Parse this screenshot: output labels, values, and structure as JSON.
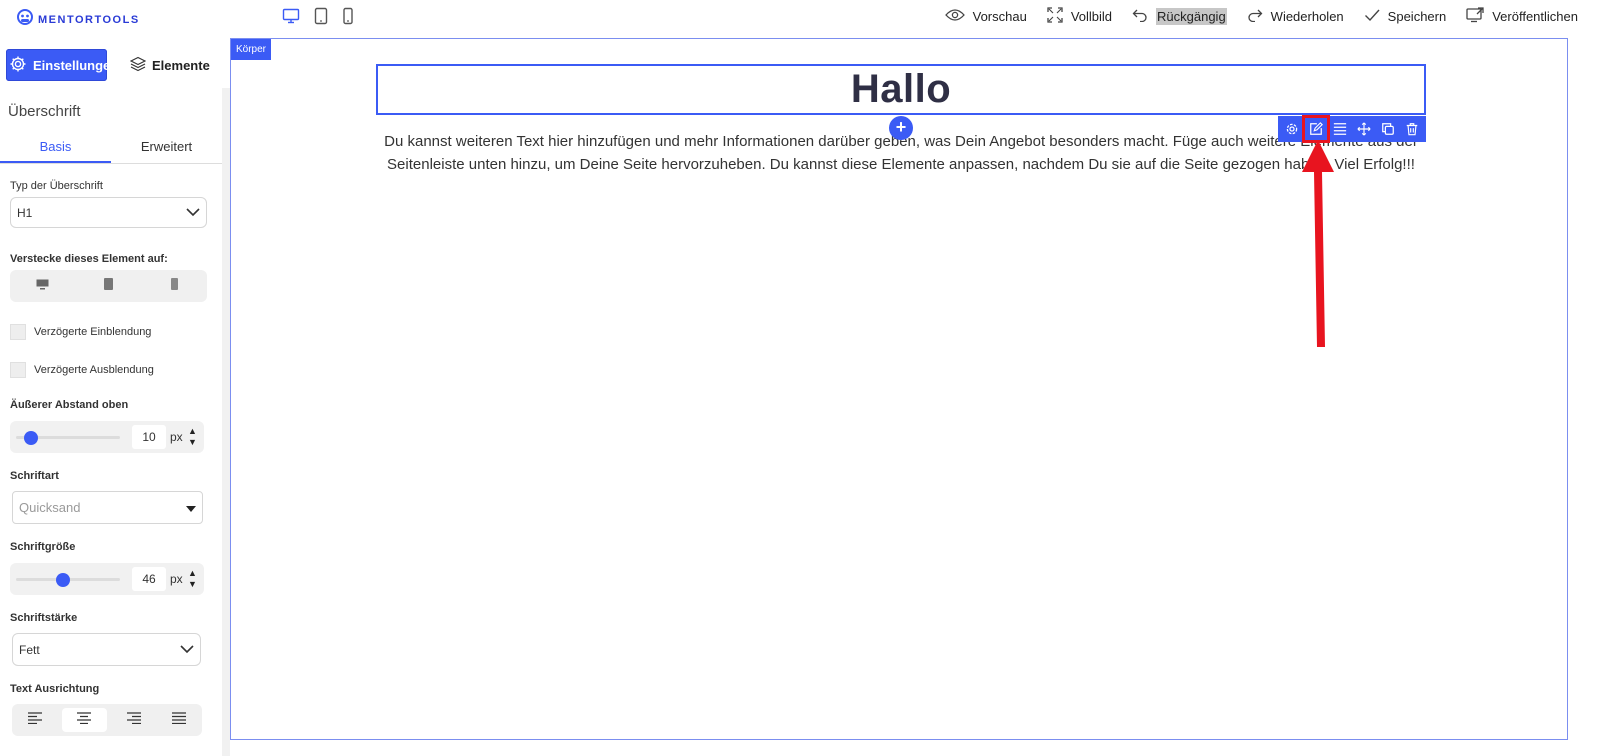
{
  "app": {
    "logo_text": "MENTORTOOLS"
  },
  "header": {
    "actions": [
      {
        "label": "Vorschau",
        "icon": "eye-icon"
      },
      {
        "label": "Vollbild",
        "icon": "fullscreen-icon"
      },
      {
        "label": "Rückgängig",
        "icon": "undo-icon",
        "highlighted": true
      },
      {
        "label": "Wiederholen",
        "icon": "redo-icon"
      },
      {
        "label": "Speichern",
        "icon": "check-icon"
      },
      {
        "label": "Veröffentlichen",
        "icon": "publish-icon"
      }
    ],
    "device_icons": [
      "desktop-icon",
      "tablet-icon",
      "mobile-icon"
    ]
  },
  "sidebar": {
    "settings_label": "Einstellungen",
    "elements_label": "Elemente",
    "panel_title": "Überschrift",
    "tabs": [
      "Basis",
      "Erweitert"
    ],
    "active_tab": "Basis",
    "heading_type_label": "Typ der Überschrift",
    "heading_type_value": "H1",
    "hide_label": "Verstecke dieses Element auf:",
    "delayed_show_label": "Verzögerte Einblendung",
    "delayed_hide_label": "Verzögerte Ausblendung",
    "margin_top_label": "Äußerer Abstand oben",
    "margin_top_value": "10",
    "margin_top_unit": "px",
    "font_label": "Schriftart",
    "font_placeholder": "Quicksand",
    "font_size_label": "Schriftgröße",
    "font_size_value": "46",
    "font_size_unit": "px",
    "font_weight_label": "Schriftstärke",
    "font_weight_value": "Fett",
    "text_align_label": "Text Ausrichtung",
    "text_align_active": "center"
  },
  "canvas": {
    "body_tag": "Körper",
    "heading": "Hallo",
    "paragraph": "Du kannst weiteren Text hier hinzufügen und mehr Informationen darüber geben, was Dein Angebot besonders macht. Füge auch weitere Elemente aus der Seitenleiste unten hinzu, um Deine Seite hervorzuheben. Du kannst diese Elemente anpassen, nachdem Du sie auf die Seite gezogen haben. Viel Erfolg!!!",
    "add_button": "+",
    "toolbar_icons": [
      "gear-icon",
      "edit-icon",
      "align-icon",
      "move-icon",
      "copy-icon",
      "trash-icon"
    ],
    "highlighted_tool": "edit-icon"
  },
  "colors": {
    "accent": "#3b5bf5",
    "annotation": "#e8141f"
  }
}
